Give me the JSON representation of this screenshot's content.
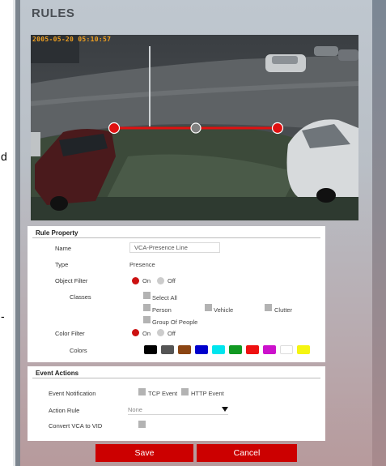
{
  "page": {
    "title": "RULES"
  },
  "edge_glyphs": {
    "upper": "d",
    "lower": "-"
  },
  "video": {
    "timestamp": "2005-05-20 05:10:57"
  },
  "rule_property": {
    "title": "Rule Property",
    "name_label": "Name",
    "name_value": "VCA-Presence Line",
    "type_label": "Type",
    "type_value": "Presence",
    "object_filter_label": "Object Filter",
    "on_label": "On",
    "off_label": "Off",
    "classes_label": "Classes",
    "classes": {
      "select_all": "Select All",
      "person": "Person",
      "vehicle": "Vehicle",
      "clutter": "Clutter",
      "group_of_people": "Group Of People"
    },
    "color_filter_label": "Color Filter",
    "colors_label": "Colors",
    "colors": [
      "#000000",
      "#555555",
      "#8b4513",
      "#0000cc",
      "#00e5ee",
      "#119922",
      "#ee1111",
      "#cc11cc",
      "#ffffff",
      "#f5f511"
    ]
  },
  "event_actions": {
    "title": "Event Actions",
    "event_notification_label": "Event Notification",
    "tcp_event": "TCP Event",
    "http_event": "HTTP Event",
    "action_rule_label": "Action Rule",
    "action_rule_value": "None",
    "convert_label": "Convert VCA to VID"
  },
  "buttons": {
    "save": "Save",
    "cancel": "Cancel"
  }
}
